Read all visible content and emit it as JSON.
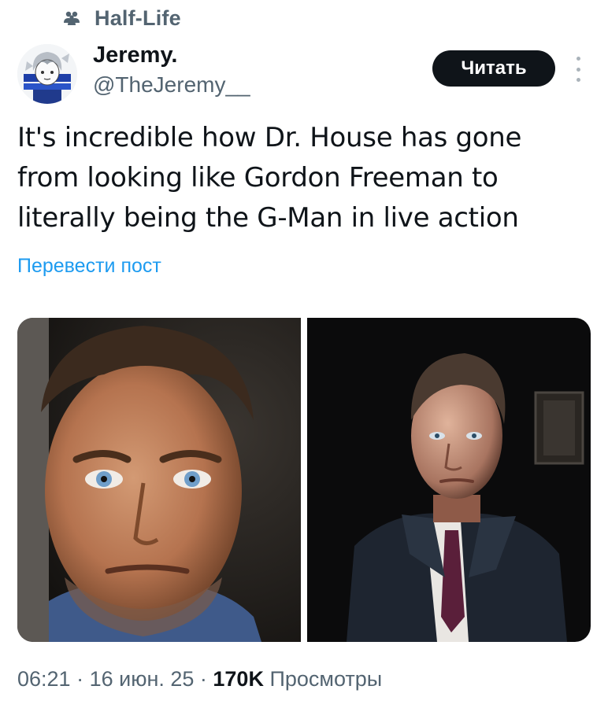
{
  "community": {
    "name": "Half-Life",
    "icon": "community-people-icon"
  },
  "author": {
    "display_name": "Jeremy.",
    "handle": "@TheJeremy__",
    "avatar": "anime-avatar"
  },
  "actions": {
    "follow_label": "Читать",
    "more_icon": "more-vertical-icon"
  },
  "tweet": {
    "text_lines": [
      "It's incredible how Dr. House has gone",
      "from looking like Gordon Freeman to",
      "literally being the G-Man in live action"
    ],
    "translate_label": "Перевести пост"
  },
  "media": [
    {
      "description": "close-up-portrait-of-man"
    },
    {
      "description": "man-in-suit-portrait"
    }
  ],
  "meta": {
    "time": "06:21",
    "separator": " · ",
    "date": "16 июн. 25",
    "views_count": "170K",
    "views_label": "Просмотры"
  },
  "colors": {
    "text_primary": "#0f1419",
    "text_secondary": "#536471",
    "link": "#1d9bf0",
    "button_bg": "#0f1419"
  }
}
